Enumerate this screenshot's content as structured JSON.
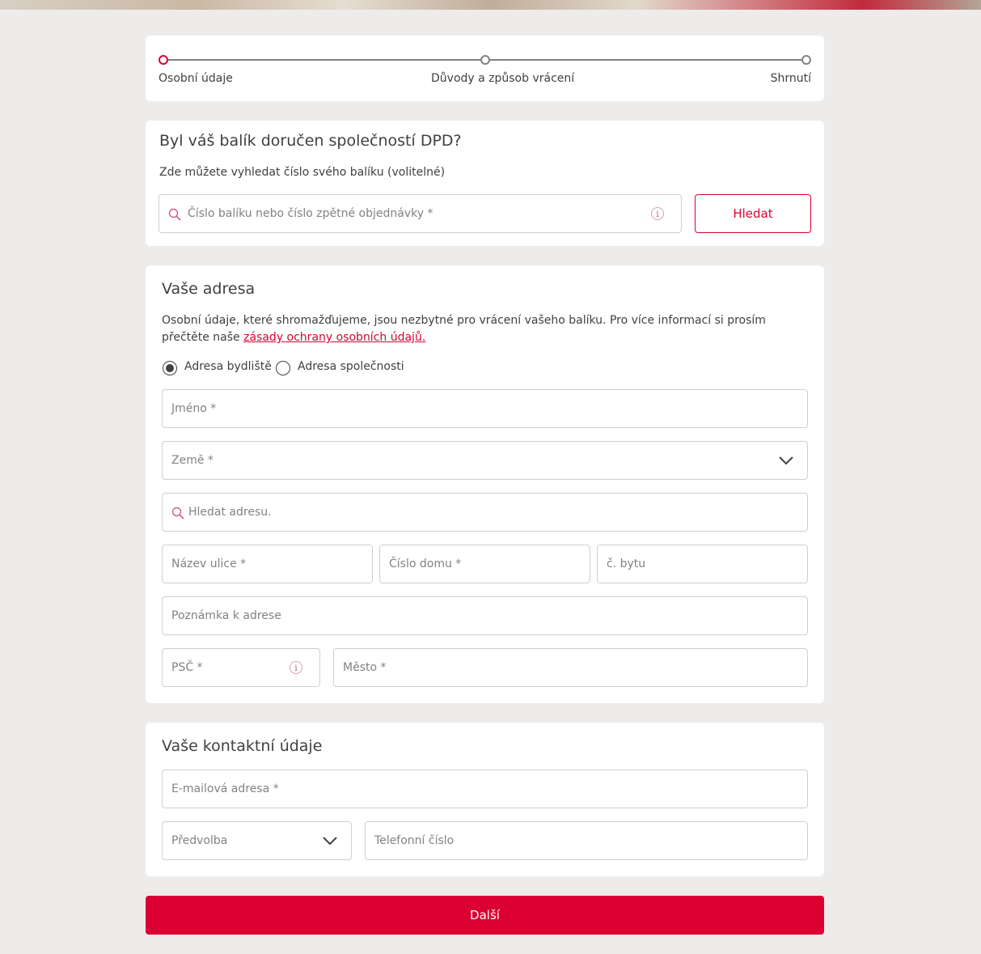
{
  "stepper": {
    "steps": [
      {
        "label": "Osobní údaje",
        "active": true
      },
      {
        "label": "Důvody a způsob vrácení",
        "active": false
      },
      {
        "label": "Shrnutí",
        "active": false
      }
    ]
  },
  "tracking": {
    "title": "Byl váš balík doručen společností DPD?",
    "subtitle": "Zde můžete vyhledat číslo svého balíku (volitelné)",
    "search_placeholder": "Číslo balíku nebo číslo zpětné objednávky *",
    "search_button": "Hledat"
  },
  "address": {
    "title": "Vaše adresa",
    "intro": "Osobní údaje, které shromažďujeme, jsou nezbytné pro vrácení vašeho balíku. Pro více informací si prosím přečtěte naše",
    "privacy_link": "zásady ochrany osobních údajů.",
    "radio_home": "Adresa bydliště",
    "radio_company": "Adresa společnosti",
    "selected": "home",
    "name_placeholder": "Jméno *",
    "country_placeholder": "Země *",
    "search_address_placeholder": "Hledat adresu.",
    "street_placeholder": "Název ulice *",
    "house_number_placeholder": "Číslo domu *",
    "flat_placeholder": "č. bytu",
    "note_placeholder": "Poznámka k adrese",
    "zip_placeholder": "PSČ *",
    "city_placeholder": "Město *"
  },
  "contact": {
    "title": "Vaše kontaktní údaje",
    "email_placeholder": "E-mailová adresa *",
    "prefix_placeholder": "Předvolba",
    "phone_placeholder": "Telefonní číslo"
  },
  "next_button": "Další",
  "colors": {
    "accent": "#dc0032",
    "text": "#414042",
    "background": "#edecea"
  }
}
